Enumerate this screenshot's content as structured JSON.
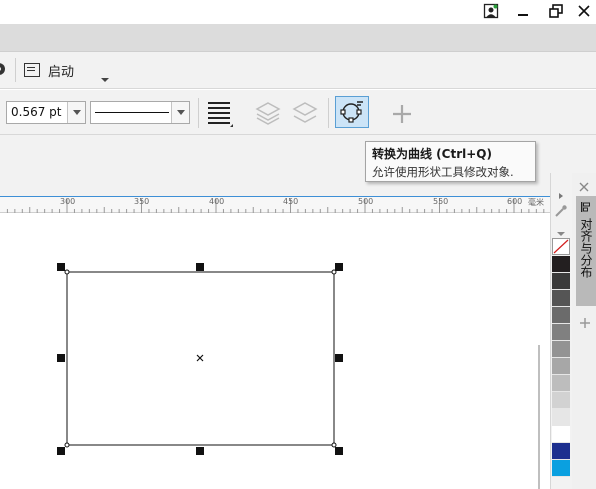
{
  "toolbar": {
    "welcome_label": "启动"
  },
  "property_bar": {
    "outline_width": "0.567 pt"
  },
  "tooltip": {
    "title": "转换为曲线 (Ctrl+Q)",
    "description": "允许使用形状工具修改对象."
  },
  "ruler": {
    "ticks": [
      "300",
      "350",
      "400",
      "450",
      "500",
      "550",
      "600"
    ],
    "unit": "毫米"
  },
  "docker": {
    "title": "对齐与分布"
  },
  "colors": {
    "accent": "#1a7ad6",
    "palette": [
      "#ffffff",
      "#231f20",
      "#3a3a3a",
      "#555555",
      "#6b6b6b",
      "#808080",
      "#939393",
      "#a7a7a7",
      "#bdbdbd",
      "#d2d2d2",
      "#e6e6e6",
      "#ffffff",
      "#1d2f8f",
      "#0aa0e0",
      "#119c4b"
    ]
  }
}
